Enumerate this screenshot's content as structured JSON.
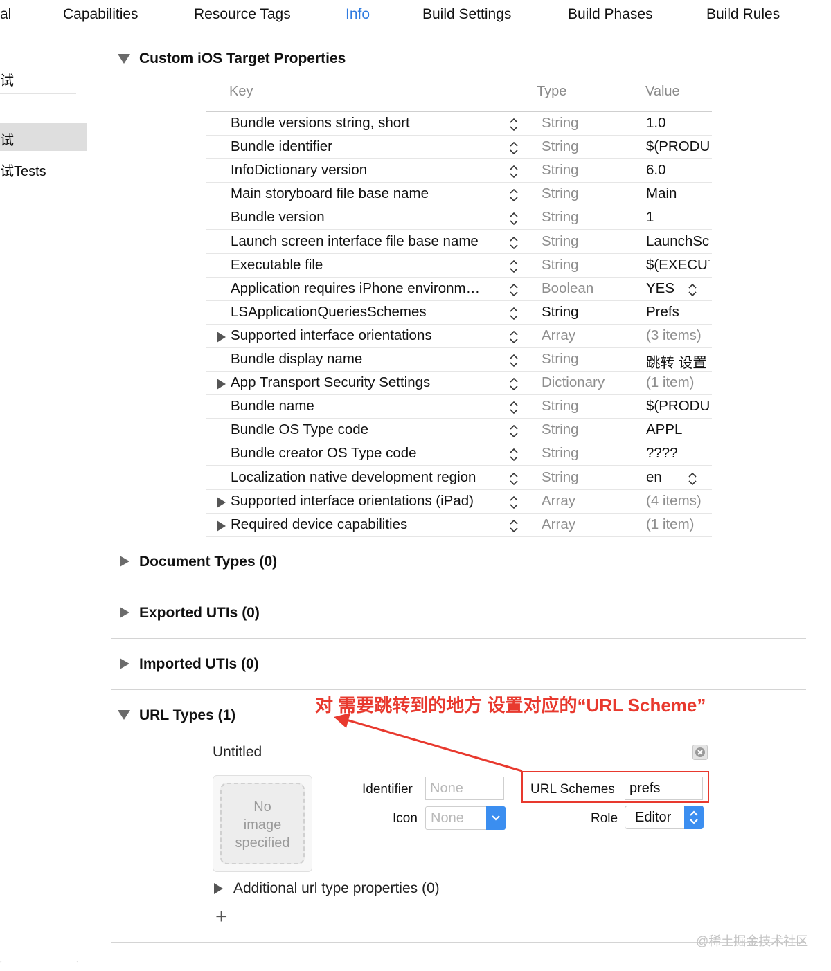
{
  "tabs": [
    {
      "label": "al"
    },
    {
      "label": "Capabilities"
    },
    {
      "label": "Resource Tags"
    },
    {
      "label": "Info",
      "active": true
    },
    {
      "label": "Build Settings"
    },
    {
      "label": "Build Phases"
    },
    {
      "label": "Build Rules"
    }
  ],
  "sidebar": {
    "items": [
      {
        "label": "试"
      },
      {
        "label": "试",
        "selected": true
      },
      {
        "label": "试Tests"
      }
    ]
  },
  "custom_properties": {
    "title": "Custom iOS Target Properties",
    "columns": {
      "key": "Key",
      "type": "Type",
      "value": "Value"
    },
    "rows": [
      {
        "key": "Bundle versions string, short",
        "type": "String",
        "value": "1.0"
      },
      {
        "key": "Bundle identifier",
        "type": "String",
        "value": "$(PRODUCT_BUNDLE_IDENTIFIER)"
      },
      {
        "key": "InfoDictionary version",
        "type": "String",
        "value": "6.0"
      },
      {
        "key": "Main storyboard file base name",
        "type": "String",
        "value": "Main"
      },
      {
        "key": "Bundle version",
        "type": "String",
        "value": "1"
      },
      {
        "key": "Launch screen interface file base name",
        "type": "String",
        "value": "LaunchScreen"
      },
      {
        "key": "Executable file",
        "type": "String",
        "value": "$(EXECUTABLE_NAME)"
      },
      {
        "key": "Application requires iPhone environm…",
        "type": "Boolean",
        "value": "YES",
        "value_popup": true
      },
      {
        "key": "LSApplicationQueriesSchemes",
        "type": "String",
        "value": "Prefs",
        "type_emphasis": true
      },
      {
        "key": "Supported interface orientations",
        "type": "Array",
        "value": "(3 items)",
        "expandable": true
      },
      {
        "key": "Bundle display name",
        "type": "String",
        "value": "跳转 设置"
      },
      {
        "key": "App Transport Security Settings",
        "type": "Dictionary",
        "value": "(1 item)",
        "expandable": true
      },
      {
        "key": "Bundle name",
        "type": "String",
        "value": "$(PRODUCT_NAME)"
      },
      {
        "key": "Bundle OS Type code",
        "type": "String",
        "value": "APPL"
      },
      {
        "key": "Bundle creator OS Type code",
        "type": "String",
        "value": "????"
      },
      {
        "key": "Localization native development region",
        "type": "String",
        "value": "en",
        "value_popup": true
      },
      {
        "key": "Supported interface orientations (iPad)",
        "type": "Array",
        "value": "(4 items)",
        "expandable": true
      },
      {
        "key": "Required device capabilities",
        "type": "Array",
        "value": "(1 item)",
        "expandable": true
      }
    ]
  },
  "sections": {
    "document_types": "Document Types (0)",
    "exported_utis": "Exported UTIs (0)",
    "imported_utis": "Imported UTIs (0)",
    "url_types": "URL Types (1)"
  },
  "url_type": {
    "name": "Untitled",
    "image_placeholder": "No image specified",
    "identifier_label": "Identifier",
    "identifier_placeholder": "None",
    "icon_label": "Icon",
    "icon_placeholder": "None",
    "url_schemes_label": "URL Schemes",
    "url_schemes_value": "prefs",
    "role_label": "Role",
    "role_value": "Editor",
    "additional_properties": "Additional url type properties (0)",
    "add_symbol": "+"
  },
  "annotation": {
    "text": "对 需要跳转到的地方 设置对应的“URL Scheme”",
    "color": "#e8392e"
  },
  "watermark": "@稀土掘金技术社区",
  "colors": {
    "accent": "#2f7be0",
    "annotation": "#e8392e"
  }
}
